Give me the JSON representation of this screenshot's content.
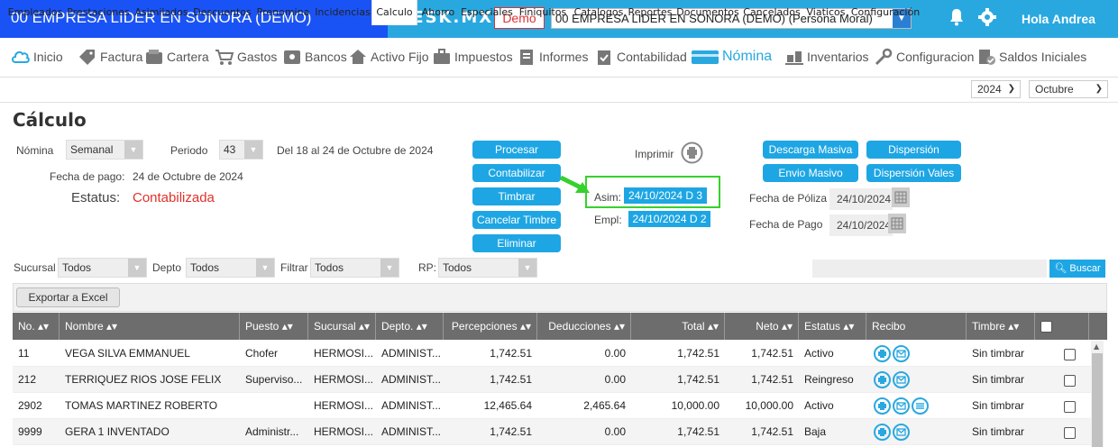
{
  "topbar": {
    "company": "00 EMPRESA LIDER EN SONORA (DEMO)",
    "logo": "TESK.MX",
    "demo_badge": "Demo",
    "company_select": "00 EMPRESA LIDER EN SONORA (DEMO) (Persona Moral)",
    "greeting": "Hola Andrea"
  },
  "modules": [
    {
      "label": "Inicio",
      "icon": "cloud-icon"
    },
    {
      "label": "Factura",
      "icon": "tag-icon"
    },
    {
      "label": "Cartera",
      "icon": "wallet-icon"
    },
    {
      "label": "Gastos",
      "icon": "cart-icon"
    },
    {
      "label": "Bancos",
      "icon": "safe-icon"
    },
    {
      "label": "Activo Fijo",
      "icon": "house-icon"
    },
    {
      "label": "Impuestos",
      "icon": "briefcase-icon"
    },
    {
      "label": "Informes",
      "icon": "document-icon"
    },
    {
      "label": "Contabilidad",
      "icon": "clipboard-icon"
    },
    {
      "label": "Nómina",
      "icon": "card-icon"
    },
    {
      "label": "Inventarios",
      "icon": "boxes-icon"
    },
    {
      "label": "Configuracion",
      "icon": "wrench-icon"
    },
    {
      "label": "Saldos Iniciales",
      "icon": "checklist-icon"
    }
  ],
  "subtabs": [
    "Empleados",
    "Prestaciones",
    "Asimilados",
    "Descuentos",
    "Prenomina",
    "Incidencias",
    "Calculo",
    "Ahorro",
    "Especiales",
    "Finiquitos",
    "Catalogos",
    "Reportes",
    "Documentos",
    "Cancelados",
    "Viaticos",
    "Configuración"
  ],
  "year": "2024",
  "month": "Octubre",
  "page_title": "Cálculo",
  "form": {
    "nomina_label": "Nómina",
    "nomina_value": "Semanal",
    "periodo_label": "Periodo",
    "periodo_value": "43",
    "periodo_range": "Del 18 al 24 de Octubre de 2024",
    "fecha_pago_label": "Fecha de pago:",
    "fecha_pago_value": "24 de Octubre de 2024",
    "estatus_label": "Estatus:",
    "estatus_value": "Contabilizada"
  },
  "actions": {
    "procesar": "Procesar",
    "contabilizar": "Contabilizar",
    "timbrar": "Timbrar",
    "cancelar_timbre": "Cancelar Timbre",
    "eliminar": "Eliminar",
    "imprimir": "Imprimir",
    "descarga_masiva": "Descarga Masiva",
    "dispersion": "Dispersión",
    "envio_masivo": "Envio Masivo",
    "dispersion_vales": "Dispersión Vales"
  },
  "polizas": {
    "asim_label": "Asim:",
    "asim_value": "24/10/2024 D 3",
    "empl_label": "Empl:",
    "empl_value": "24/10/2024 D 2",
    "fecha_poliza_label": "Fecha de Póliza",
    "fecha_poliza_value": "24/10/2024",
    "fecha_pago_label": "Fecha de Pago",
    "fecha_pago_value": "24/10/2024"
  },
  "filters": {
    "sucursal_label": "Sucursal",
    "sucursal_value": "Todos",
    "depto_label": "Depto",
    "depto_value": "Todos",
    "filtrar_label": "Filtrar",
    "filtrar_value": "Todos",
    "rp_label": "RP:",
    "rp_value": "Todos",
    "search_value": "",
    "buscar_label": "Buscar"
  },
  "export_label": "Exportar a Excel",
  "table": {
    "columns": [
      "No.",
      "Nombre",
      "Puesto",
      "Sucursal",
      "Depto.",
      "Percepciones",
      "Deducciones",
      "Total",
      "Neto",
      "Estatus",
      "Recibo",
      "Timbre"
    ],
    "rows": [
      {
        "no": "11",
        "nombre": "VEGA SILVA EMMANUEL",
        "puesto": "Chofer",
        "sucursal": "HERMOSI...",
        "depto": "ADMINIST...",
        "percepciones": "1,742.51",
        "deducciones": "0.00",
        "total": "1,742.51",
        "neto": "1,742.51",
        "estatus": "Activo",
        "timbre": "Sin timbrar",
        "icons": 2
      },
      {
        "no": "212",
        "nombre": "TERRIQUEZ RIOS JOSE FELIX",
        "puesto": "Superviso...",
        "sucursal": "HERMOSI...",
        "depto": "ADMINIST...",
        "percepciones": "1,742.51",
        "deducciones": "0.00",
        "total": "1,742.51",
        "neto": "1,742.51",
        "estatus": "Reingreso",
        "timbre": "Sin timbrar",
        "icons": 2
      },
      {
        "no": "2902",
        "nombre": "TOMAS MARTINEZ ROBERTO",
        "puesto": "",
        "sucursal": "HERMOSI...",
        "depto": "ADMINIST...",
        "percepciones": "12,465.64",
        "deducciones": "2,465.64",
        "total": "10,000.00",
        "neto": "10,000.00",
        "estatus": "Activo",
        "timbre": "Sin timbrar",
        "icons": 3
      },
      {
        "no": "9999",
        "nombre": "GERA 1 INVENTADO",
        "puesto": "Administr...",
        "sucursal": "HERMOSI...",
        "depto": "ADMINIST...",
        "percepciones": "1,742.51",
        "deducciones": "0.00",
        "total": "1,742.51",
        "neto": "1,742.51",
        "estatus": "Baja",
        "timbre": "Sin timbrar",
        "icons": 2
      }
    ]
  },
  "colors": {
    "brand_blue": "#1a53f5",
    "topbar": "#29a8e0",
    "action": "#1ea6e4",
    "status_red": "#e0312b",
    "highlight": "#36d12c"
  }
}
